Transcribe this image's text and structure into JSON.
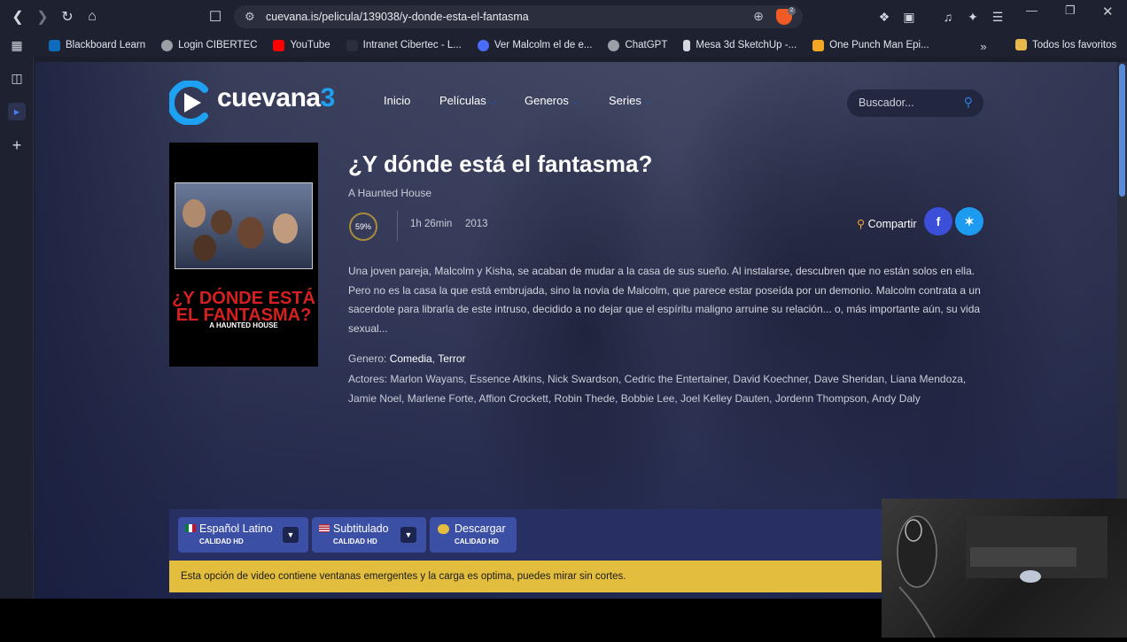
{
  "browser": {
    "url": "cuevana.is/pelicula/139038/y-donde-esta-el-fantasma",
    "brave_badge": "2",
    "bookmarks": [
      {
        "label": "Blackboard Learn",
        "color": "#0f6cbd"
      },
      {
        "label": "Login CIBERTEC",
        "color": "#9aa0a6"
      },
      {
        "label": "YouTube",
        "color": "#ff0000"
      },
      {
        "label": "Intranet Cibertec - L...",
        "color": "#2b2e3d"
      },
      {
        "label": "Ver Malcolm el de e...",
        "color": "#4a6cf7"
      },
      {
        "label": "ChatGPT",
        "color": "#9aa0a6"
      },
      {
        "label": "Mesa 3d SketchUp -...",
        "color": "#d6d8e0"
      },
      {
        "label": "One Punch Man Epi...",
        "color": "#f5a623"
      }
    ],
    "all_favorites": "Todos los favoritos"
  },
  "site": {
    "logo_text": "cuevana",
    "logo_number": "3",
    "menu": [
      "Inicio",
      "Películas",
      "Generos",
      "Series"
    ],
    "search_placeholder": "Buscador..."
  },
  "movie": {
    "title": "¿Y dónde está el fantasma?",
    "original_title": "A Haunted House",
    "rating": "59%",
    "duration": "1h 26min",
    "year": "2013",
    "share_label": "Compartir",
    "description": "Una joven pareja, Malcolm y Kisha, se acaban de mudar a la casa de sus sueño. Al instalarse, descubren que no están solos en ella. Pero no es la casa la que está embrujada, sino la novia de Malcolm, que parece estar poseída por un demonio. Malcolm contrata a un sacerdote para librarla de este intruso, decidido a no dejar que el espíritu maligno arruine su relación... o, más importante aún, su vida sexual...",
    "genre_label": "Genero:",
    "genres": [
      "Comedia",
      "Terror"
    ],
    "actors_label": "Actores:",
    "actors": "Marlon Wayans, Essence Atkins, Nick Swardson, Cedric the Entertainer, David Koechner, Dave Sheridan, Liana Mendoza, Jamie Noel, Marlene Forte, Affion Crockett, Robin Thede, Bobbie Lee, Joel Kelley Dauten, Jordenn Thompson, Andy Daly",
    "poster_title_line1": "¿Y DÓNDE ESTÁ",
    "poster_title_line2": "EL FANTASMA?",
    "poster_subtitle": "A HAUNTED HOUSE"
  },
  "player": {
    "options": [
      {
        "label": "Español Latino",
        "quality": "CALIDAD HD"
      },
      {
        "label": "Subtitulado",
        "quality": "CALIDAD HD"
      },
      {
        "label": "Descargar",
        "quality": "CALIDAD HD"
      }
    ],
    "notice": "Esta opción de video contiene ventanas emergentes y la carga es optima, puedes mirar sin cortes."
  },
  "colors": {
    "accent_blue": "#1ea1f2",
    "facebook": "#3b4fd8",
    "twitter": "#1d9bf0",
    "notice_bg": "#e3bd3e",
    "player_option": "#3b4fa5"
  }
}
